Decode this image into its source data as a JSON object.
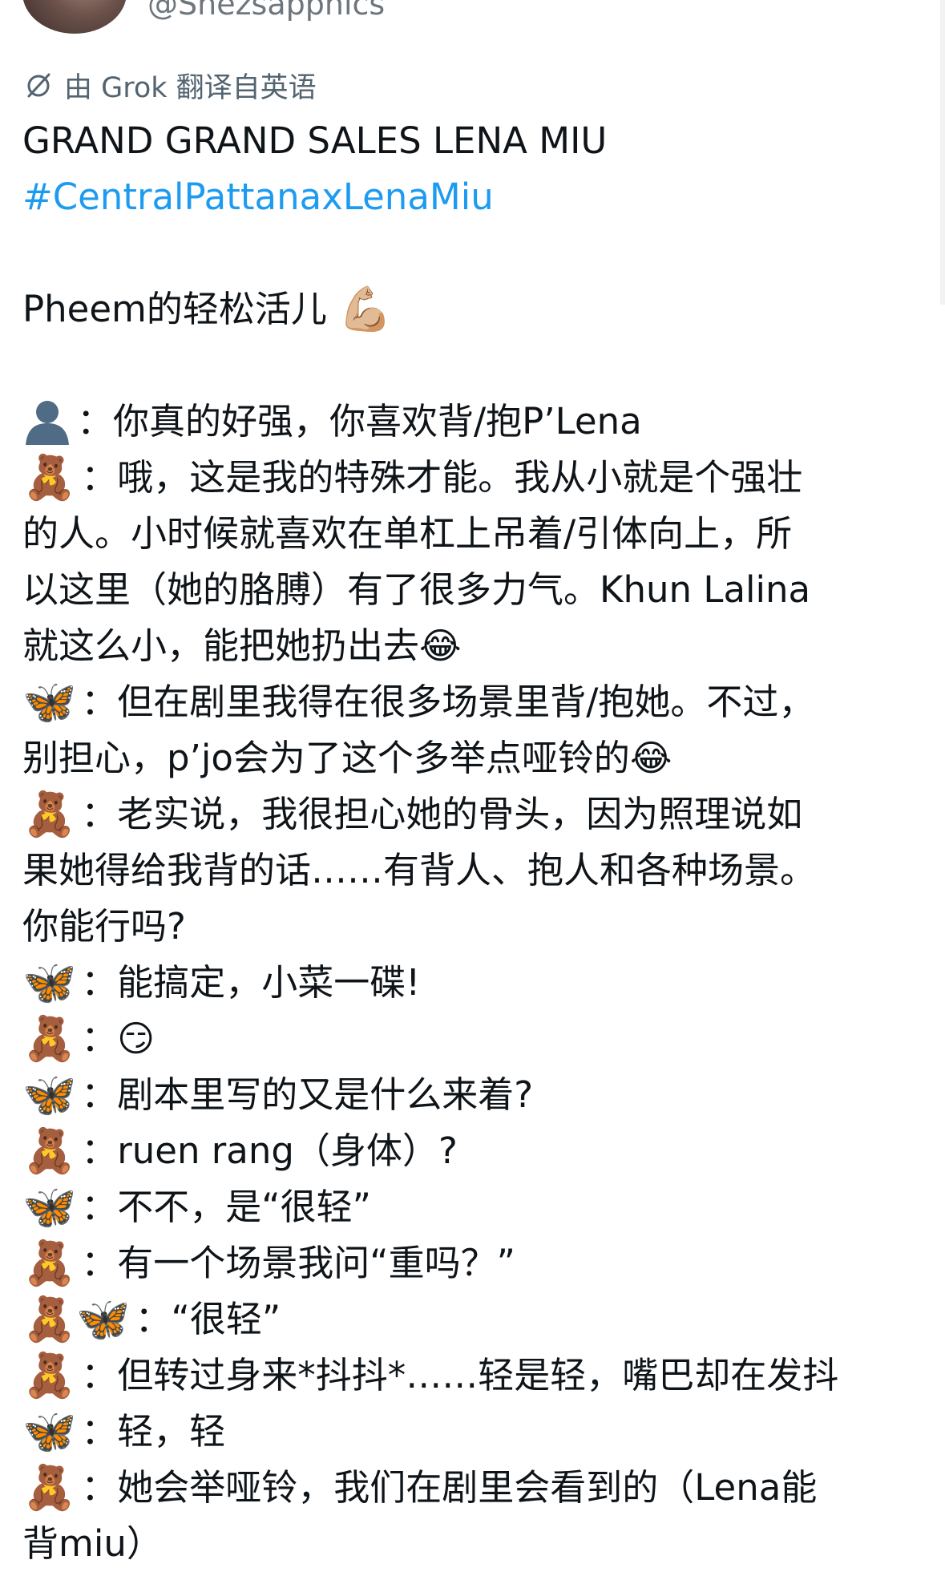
{
  "author": {
    "handle": "@Snezsapphics"
  },
  "translation": {
    "notice": "由 Grok 翻译自英语"
  },
  "tweet": {
    "title": "GRAND GRAND SALES LENA MIU",
    "hashtag": "#CentralPattanaxLenaMiu",
    "intro_text": "Pheem的轻松活儿",
    "intro_emoji": "💪🏼",
    "lines": [
      {
        "speaker": "👤",
        "text": "你真的好强，你喜欢背/抱P’Lena"
      },
      {
        "speaker": "🧸",
        "text": "哦，这是我的特殊才能。我从小就是个强壮"
      },
      {
        "text": "的人。小时候就喜欢在单杠上吊着/引体向上，所"
      },
      {
        "text": "以这里（她的胳膊）有了很多力气。Khun Lalina"
      },
      {
        "text": "就这么小，能把她扔出去😂"
      },
      {
        "speaker": "🦋",
        "text": "但在剧里我得在很多场景里背/抱她。不过，"
      },
      {
        "text": "别担心，p’jo会为了这个多举点哑铃的😂"
      },
      {
        "speaker": "🧸",
        "text": "老实说，我很担心她的骨头，因为照理说如"
      },
      {
        "text": "果她得给我背的话……有背人、抱人和各种场景。"
      },
      {
        "text": "你能行吗?"
      },
      {
        "speaker": "🦋",
        "text": "能搞定，小菜一碟!"
      },
      {
        "speaker": "🧸",
        "text": "😏"
      },
      {
        "speaker": "🦋",
        "text": "剧本里写的又是什么来着?"
      },
      {
        "speaker": "🧸",
        "text": "ruen rang（身体）?"
      },
      {
        "speaker": "🦋",
        "text": "不不，是“很轻”"
      },
      {
        "speaker": "🧸",
        "text": "有一个场景我问“重吗？”"
      },
      {
        "speaker": "🧸🦋",
        "text": "“很轻”"
      },
      {
        "speaker": "🧸",
        "text": "但转过身来*抖抖*……轻是轻，嘴巴却在发抖"
      },
      {
        "speaker": "🦋",
        "text": "轻，轻"
      },
      {
        "speaker": "🧸",
        "text": "她会举哑铃，我们在剧里会看到的（Lena能"
      },
      {
        "text": "背miu）"
      }
    ]
  },
  "colors": {
    "text": "#0f1419",
    "secondary": "#536471",
    "link": "#1d9bf0"
  }
}
